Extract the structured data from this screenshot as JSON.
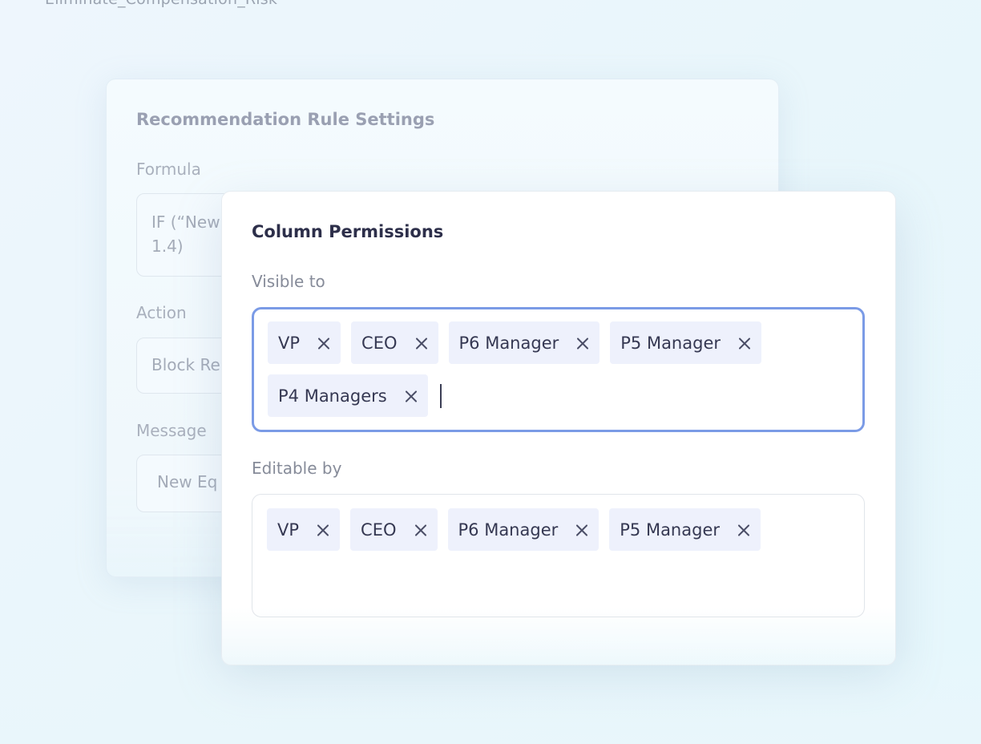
{
  "background_title": "Eliminate_Compensation_Risk",
  "rule_settings": {
    "title": "Recommendation Rule Settings",
    "formula_label": "Formula",
    "formula_value": "IF (“New\n1.4)",
    "action_label": "Action",
    "action_value": "Block Re",
    "message_label": "Message",
    "message_value": "New Eq"
  },
  "modal": {
    "title": "Column Permissions",
    "visible_label": "Visible to",
    "visible_tags": [
      "VP",
      "CEO",
      "P6 Manager",
      "P5 Manager",
      "P4 Managers"
    ],
    "editable_label": "Editable by",
    "editable_tags": [
      "VP",
      "CEO",
      "P6 Manager",
      "P5 Manager"
    ]
  },
  "colors": {
    "focus_border": "#7b9be6",
    "chip_bg": "#eef1fc",
    "title_text": "#2d2f4a"
  },
  "icons": {
    "remove": "close-icon"
  }
}
